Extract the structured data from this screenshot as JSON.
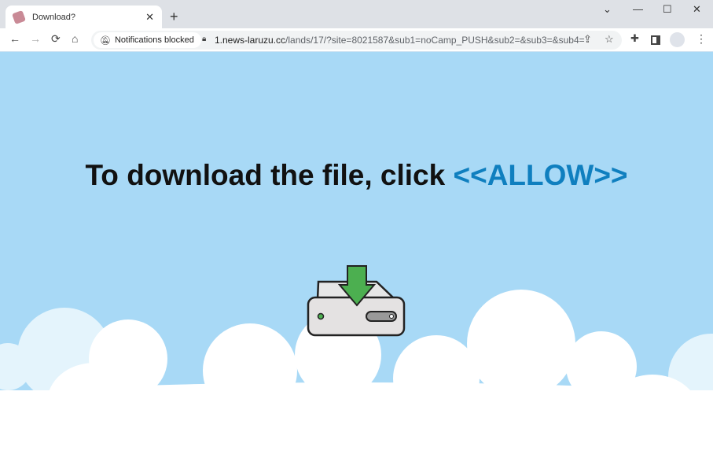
{
  "tab": {
    "title": "Download?",
    "close": "✕"
  },
  "new_tab": "+",
  "window": {
    "dropdown": "⌄",
    "minimize": "—",
    "maximize": "☐",
    "close": "✕"
  },
  "nav": {
    "back": "←",
    "forward": "→",
    "reload": "⟳",
    "home": "⌂"
  },
  "omnibox": {
    "chip": "Notifications blocked",
    "url_host": "1.news-laruzu.cc",
    "url_path": "/lands/17/?site=8021587&sub1=noCamp_PUSH&sub2=&sub3=&sub4="
  },
  "page": {
    "headline": "To download the file, click ",
    "allow": "<<ALLOW>>"
  },
  "colors": {
    "sky": "#a8d9f6",
    "allow": "#0f7fbf",
    "arrow": "#4caf50"
  }
}
